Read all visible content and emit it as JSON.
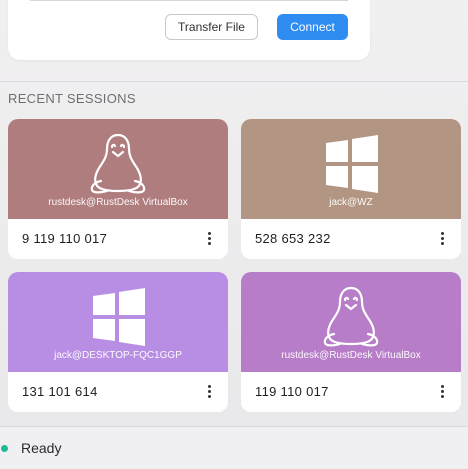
{
  "connect_panel": {
    "transfer_file_label": "Transfer File",
    "connect_label": "Connect"
  },
  "recent_sessions": {
    "title": "RECENT SESSIONS",
    "items": [
      {
        "host": "rustdesk@RustDesk VirtualBox",
        "id": "9 119 110 017",
        "os_icon": "linux-tux-icon",
        "color": "#b07d7f"
      },
      {
        "host": "jack@WZ",
        "id": "528 653 232",
        "os_icon": "windows-icon",
        "color": "#b29582"
      },
      {
        "host": "jack@DESKTOP-FQC1GGP",
        "id": "131 101 614",
        "os_icon": "windows-icon",
        "color": "#b88ee4"
      },
      {
        "host": "rustdesk@RustDesk VirtualBox",
        "id": "119 110 017",
        "os_icon": "linux-tux-icon",
        "color": "#b77dc8"
      }
    ]
  },
  "status": {
    "text": "Ready",
    "indicator_color": "#21b896"
  },
  "colors": {
    "accent": "#2f8cf0"
  }
}
